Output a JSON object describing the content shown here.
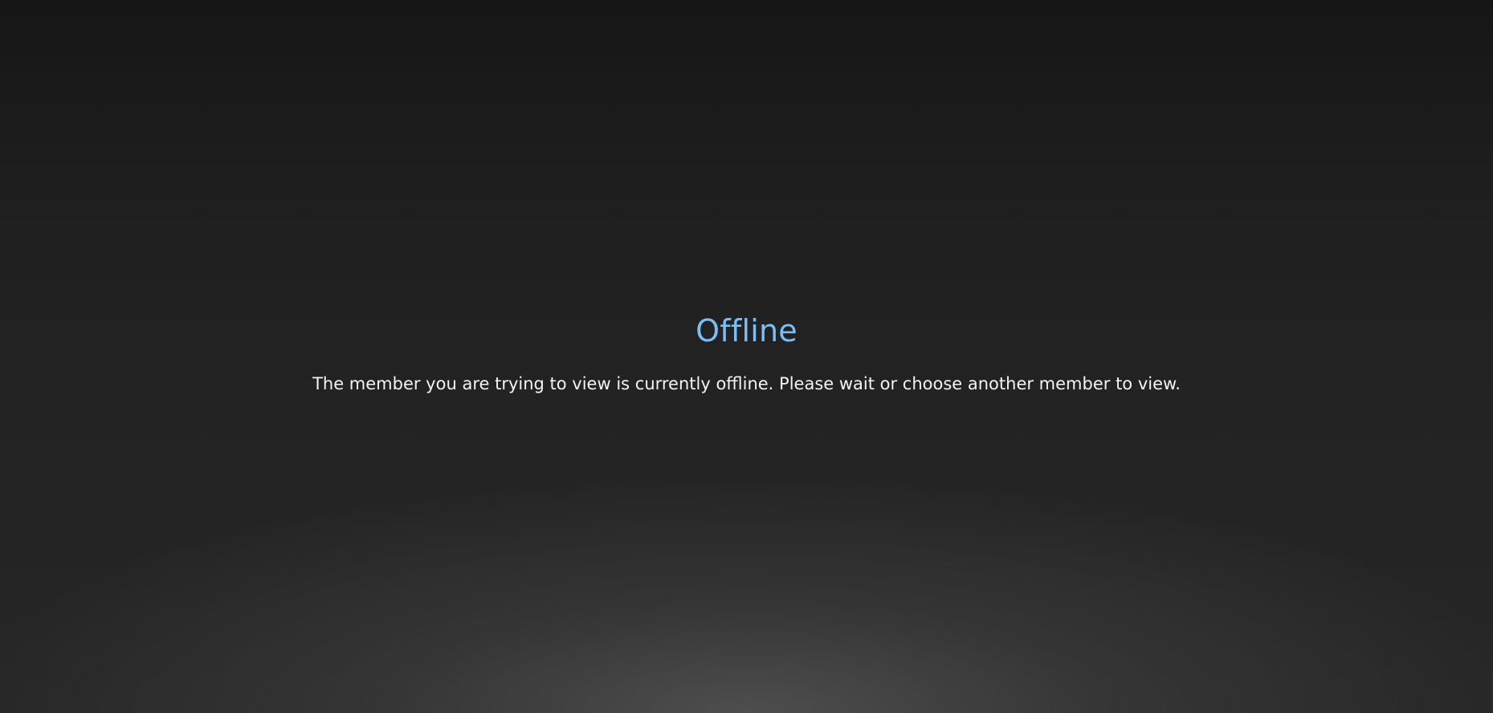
{
  "offline": {
    "title": "Offline",
    "message": "The member you are trying to view is currently offline. Please wait or choose another member to view."
  },
  "colors": {
    "title": "#7cbdf4",
    "text": "#f3f3f3",
    "background_top": "#161616",
    "background_bottom": "#262626",
    "glow": "#505050"
  }
}
